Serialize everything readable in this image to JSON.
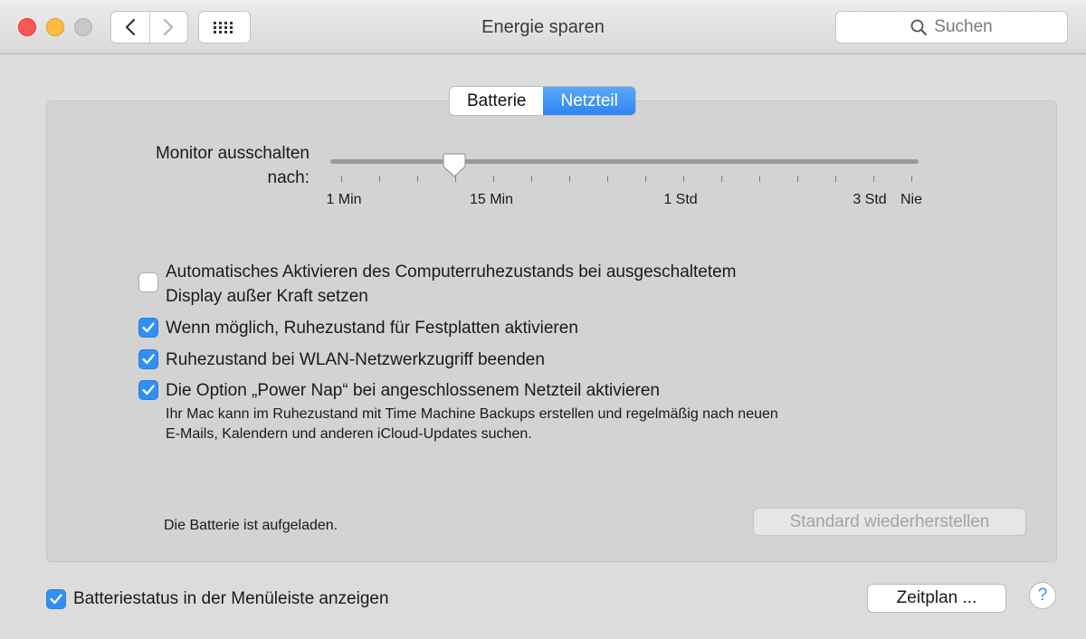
{
  "window": {
    "title": "Energie sparen",
    "search_placeholder": "Suchen",
    "traffic_lights": {
      "close": "#fc5753",
      "minimize": "#fdbc40",
      "zoom": "#c8c8c8"
    },
    "icons": {
      "back": "chevron-left-icon",
      "forward": "chevron-right-icon",
      "grid": "grid-icon",
      "search": "search-icon"
    }
  },
  "tabs": [
    {
      "label": "Batterie",
      "active": false
    },
    {
      "label": "Netzteil",
      "active": true
    }
  ],
  "slider": {
    "label_line1": "Monitor ausschalten",
    "label_line2": "nach:",
    "tick_labels": [
      "1 Min",
      "15 Min",
      "1 Std",
      "3 Std",
      "Nie"
    ],
    "value": "15 Min"
  },
  "options": [
    {
      "line1": "Automatisches Aktivieren des Computerruhezustands bei ausgeschaltetem",
      "line2": "Display außer Kraft setzen",
      "checked": false
    },
    {
      "label": "Wenn möglich, Ruhezustand für Festplatten aktivieren",
      "checked": true
    },
    {
      "label": "Ruhezustand bei WLAN-Netzwerkzugriff beenden",
      "checked": true
    },
    {
      "label": "Die Option „Power Nap“ bei angeschlossenem Netzteil aktivieren",
      "checked": true,
      "note_line1": "Ihr Mac kann im Ruhezustand mit Time Machine Backups erstellen und regelmäßig nach neuen",
      "note_line2": "E-Mails, Kalendern und anderen iCloud-Updates suchen."
    }
  ],
  "status": "Die Batterie ist aufgeladen.",
  "restore_button": "Standard wiederherstellen",
  "bottom": {
    "battery_status_label": "Batteriestatus in der Menüleiste anzeigen",
    "battery_status_checked": true,
    "schedule_button": "Zeitplan ...",
    "help_button": "?"
  },
  "colors": {
    "accent": "#2f8ff5",
    "tab_active": "#3a8ff3"
  }
}
